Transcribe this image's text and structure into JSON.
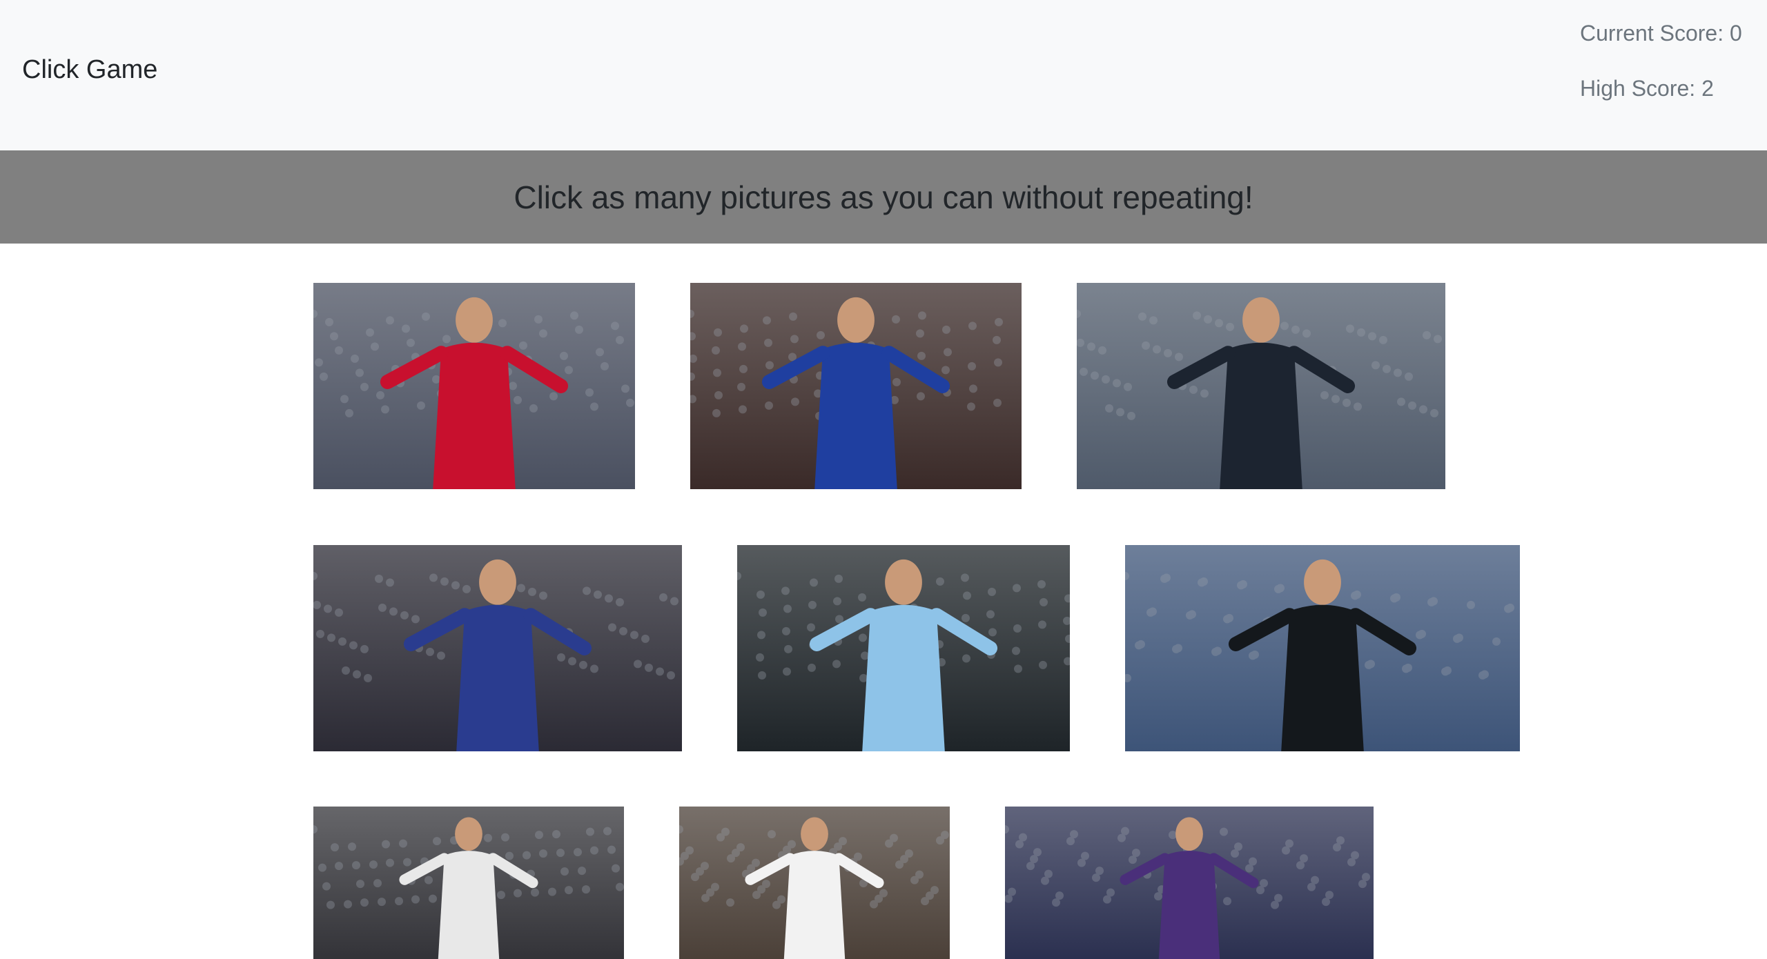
{
  "navbar": {
    "brand": "Click Game",
    "current_score_label": "Current Score: 0",
    "high_score_label": "High Score: 2"
  },
  "banner": {
    "message": "Click as many pictures as you can without repeating!"
  },
  "cards": [
    {
      "name": "card-player-red-kit",
      "kit": "#c8102e",
      "bg": "#4a5060"
    },
    {
      "name": "card-player-blue-kit",
      "kit": "#1f3fa0",
      "bg": "#3a2a28"
    },
    {
      "name": "card-player-dark-kit",
      "kit": "#1c2430",
      "bg": "#4f5a6a"
    },
    {
      "name": "card-player-striped-kit",
      "kit": "#2a3c8f",
      "bg": "#2b2a34"
    },
    {
      "name": "card-player-skyblue-kit",
      "kit": "#8ec3e8",
      "bg": "#1e2428"
    },
    {
      "name": "card-player-black-kit",
      "kit": "#14181c",
      "bg": "#3d5478"
    },
    {
      "name": "card-player-bw-stripes-kit",
      "kit": "#e8e8e8",
      "bg": "#333338"
    },
    {
      "name": "card-player-white-kit",
      "kit": "#f2f2f2",
      "bg": "#4b4038"
    },
    {
      "name": "card-player-purple-kit",
      "kit": "#4a2f7a",
      "bg": "#2b3050"
    }
  ]
}
